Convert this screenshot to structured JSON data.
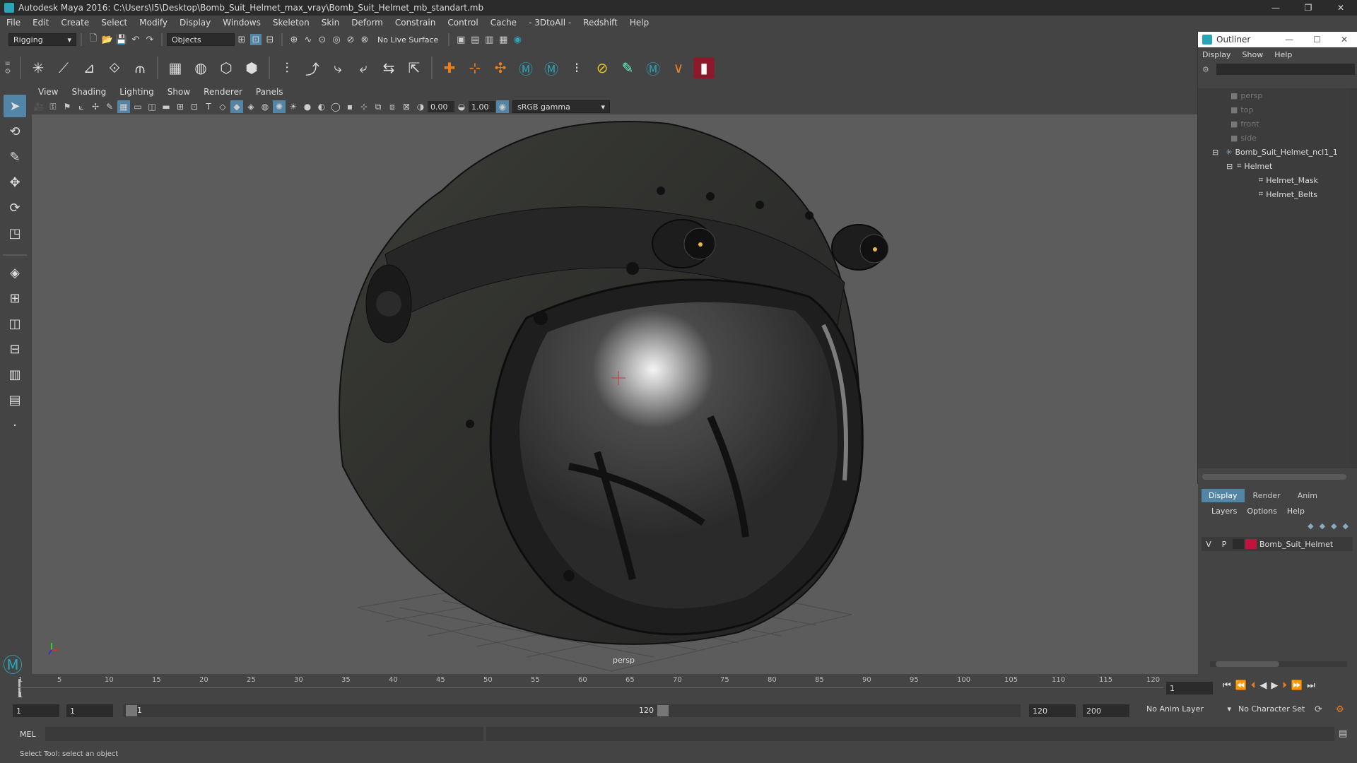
{
  "window": {
    "title": "Autodesk Maya 2016: C:\\Users\\I5\\Desktop\\Bomb_Suit_Helmet_max_vray\\Bomb_Suit_Helmet_mb_standart.mb"
  },
  "menubar": [
    "File",
    "Edit",
    "Create",
    "Select",
    "Modify",
    "Display",
    "Windows",
    "Skeleton",
    "Skin",
    "Deform",
    "Constrain",
    "Control",
    "Cache",
    "- 3DtoAll -",
    "Redshift",
    "Help"
  ],
  "status": {
    "mode": "Rigging",
    "selection_mask": "Objects",
    "live_surface": "No Live Surface"
  },
  "viewport": {
    "menu": [
      "View",
      "Shading",
      "Lighting",
      "Show",
      "Renderer",
      "Panels"
    ],
    "exposure": "0.00",
    "gamma": "1.00",
    "color_space": "sRGB gamma",
    "camera_label": "persp"
  },
  "outliner": {
    "title": "Outliner",
    "menu": [
      "Display",
      "Show",
      "Help"
    ],
    "items": [
      {
        "label": "persp",
        "depth": 0,
        "type": "camera",
        "dim": true
      },
      {
        "label": "top",
        "depth": 0,
        "type": "camera",
        "dim": true
      },
      {
        "label": "front",
        "depth": 0,
        "type": "camera",
        "dim": true
      },
      {
        "label": "side",
        "depth": 0,
        "type": "camera",
        "dim": true
      },
      {
        "label": "Bomb_Suit_Helmet_ncl1_1",
        "depth": 0,
        "type": "group",
        "dim": false
      },
      {
        "label": "Helmet",
        "depth": 1,
        "type": "mesh",
        "dim": false
      },
      {
        "label": "Helmet_Mask",
        "depth": 2,
        "type": "mesh",
        "dim": false
      },
      {
        "label": "Helmet_Belts",
        "depth": 2,
        "type": "mesh",
        "dim": false
      }
    ]
  },
  "layers": {
    "tabs": [
      "Display",
      "Render",
      "Anim"
    ],
    "menu": [
      "Layers",
      "Options",
      "Help"
    ],
    "rows": [
      {
        "v": "V",
        "p": "P",
        "name": "Bomb_Suit_Helmet",
        "color": "#c0143c"
      }
    ]
  },
  "timeline": {
    "ticks": [
      "1",
      "5",
      "10",
      "15",
      "20",
      "25",
      "30",
      "35",
      "40",
      "45",
      "50",
      "55",
      "60",
      "65",
      "70",
      "75",
      "80",
      "85",
      "90",
      "95",
      "100",
      "105",
      "110",
      "115",
      "120"
    ],
    "current_frame": "1",
    "current_frame_field": "1"
  },
  "range": {
    "start": "1",
    "start2": "1",
    "slider_start": "1",
    "slider_end": "120",
    "end": "120",
    "end2": "200",
    "anim_layer": "No Anim Layer",
    "char_set": "No Character Set"
  },
  "cmdline": {
    "lang": "MEL"
  },
  "helpline": {
    "text": "Select Tool: select an object"
  }
}
